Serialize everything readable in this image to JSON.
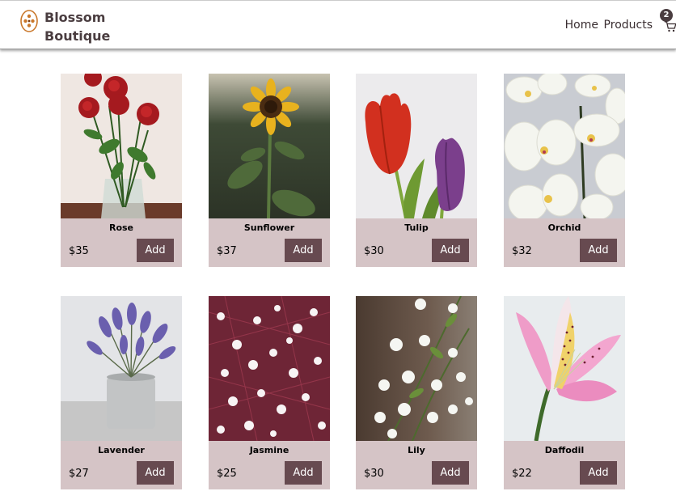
{
  "brand": {
    "line1": "Blossom",
    "line2": "Boutique"
  },
  "nav": {
    "home": "Home",
    "products": "Products"
  },
  "cart": {
    "count": "2",
    "icon": "cart-icon"
  },
  "add_label": "Add",
  "products": [
    {
      "name": "Rose",
      "price": "$35"
    },
    {
      "name": "Sunflower",
      "price": "$37"
    },
    {
      "name": "Tulip",
      "price": "$30"
    },
    {
      "name": "Orchid",
      "price": "$32"
    },
    {
      "name": "Lavender",
      "price": "$27"
    },
    {
      "name": "Jasmine",
      "price": "$25"
    },
    {
      "name": "Lily",
      "price": "$30"
    },
    {
      "name": "Daffodil",
      "price": "$22"
    }
  ],
  "colors": {
    "accent": "#674a50",
    "card": "#d5c4c6",
    "logo": "#c9772a"
  }
}
